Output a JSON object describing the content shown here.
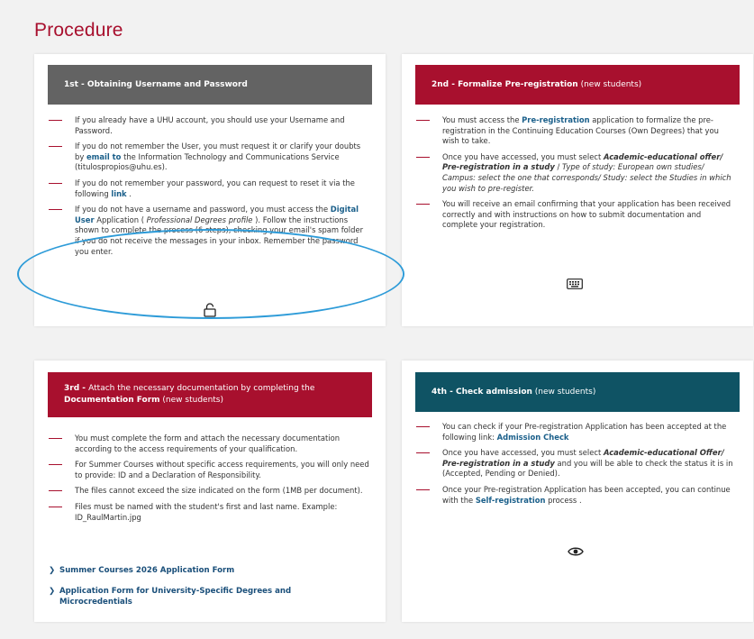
{
  "page_title": "Procedure",
  "cards": {
    "c1": {
      "header": {
        "bold": "1st - Obtaining Username and Password",
        "rest": ""
      },
      "items": [
        {
          "a": "If you already have a UHU account, you should use your Username and Password."
        },
        {
          "a": "If you do not remember the User, you must request it or clarify your doubts by ",
          "link": "email to",
          "b": " the Information Technology and Communications Service (titulospropios@uhu.es)."
        },
        {
          "a": "If you do not remember your password, you can request to reset it via the following ",
          "link": "link",
          "b": " ."
        },
        {
          "a": "If you do not have a username and password, you must access the ",
          "link": "Digital User",
          "b": " Application ( ",
          "italic": "Professional Degrees profile",
          "c": " ). Follow the instructions shown to complete the process (6 steps), checking your email's spam folder if you do not receive the messages in your inbox. Remember the password you enter."
        }
      ],
      "icon": "unlock-icon"
    },
    "c2": {
      "header": {
        "bold": "2nd - Formalize Pre-registration",
        "rest": " (new students)"
      },
      "items": [
        {
          "a": "You must access the ",
          "link": "Pre-registration",
          "b": " application to formalize the pre-registration in the Continuing Education Courses (Own Degrees) that you wish to take."
        },
        {
          "a": "Once you have accessed, you must select ",
          "bi": "Academic-educational offer/ Pre-registration in a study",
          "c": " / ",
          "italic": "Type of study: European own studies/ Campus: select the one that corresponds/ Study: select the Studies in which you wish to pre-register."
        },
        {
          "a": "You will receive an email confirming that your application has been received correctly and with instructions on how to submit documentation and complete your registration."
        }
      ],
      "icon": "keyboard-icon"
    },
    "c3": {
      "header": {
        "bold": "3rd - ",
        "rest": "Attach the necessary documentation by completing the ",
        "bold2": "Documentation Form",
        "rest2": " (new students)"
      },
      "items": [
        {
          "a": "You must complete the form and attach the necessary documentation according to the access requirements of your qualification."
        },
        {
          "a": "For Summer Courses without specific access requirements, you will only need to provide: ID and a Declaration of Responsibility."
        },
        {
          "a": "The files cannot exceed the size indicated on the form (1MB per document)."
        },
        {
          "a": "Files must be named with the student's first and last name. Example: ID_RaulMartin.jpg"
        }
      ],
      "links": [
        {
          "label": "Summer Courses 2026 Application Form"
        },
        {
          "label": "Application Form for University-Specific Degrees and Microcredentials"
        }
      ]
    },
    "c4": {
      "header": {
        "bold": "4th - Check admission",
        "rest": " (new students)"
      },
      "items": [
        {
          "a": "You can check if your Pre-registration Application has been accepted at the following link: ",
          "link": "Admission Check"
        },
        {
          "a": "Once you have accessed, you must select ",
          "bi": "Academic-educational Offer/ Pre-registration in a study",
          "c": " and you will be able to check the status it is in (Accepted, Pending or Denied)."
        },
        {
          "a": "Once your Pre-registration Application has been accepted, you can continue with the ",
          "link": "Self-registration",
          "b": " process ."
        }
      ],
      "icon": "eye-icon"
    }
  }
}
